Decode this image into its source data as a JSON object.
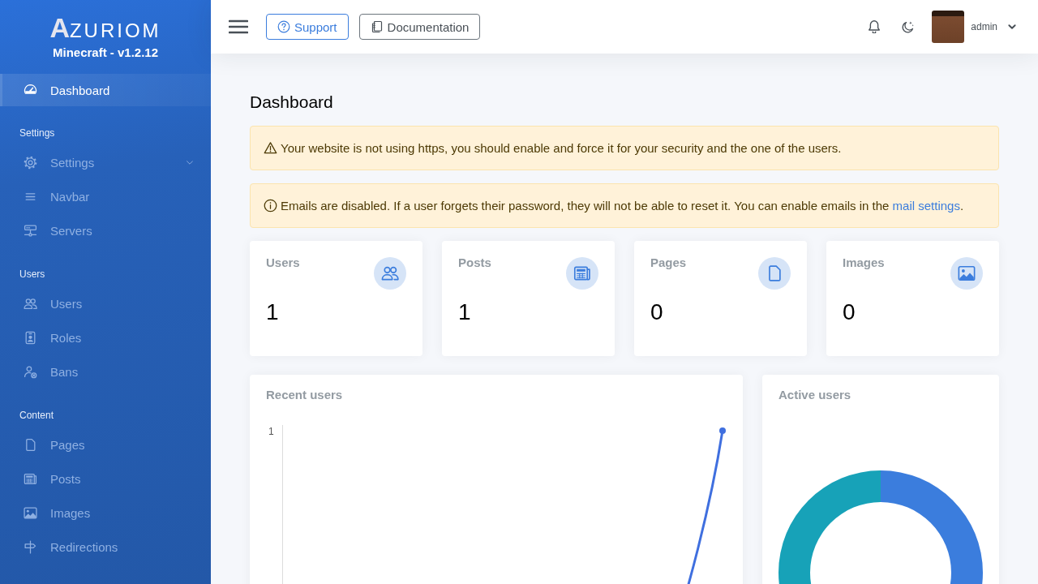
{
  "sidebar": {
    "logo": "**A**ZURIOM",
    "subtitle": "Minecraft - v1.2.12",
    "sections": [
      {
        "items": [
          {
            "label": "Dashboard",
            "kind": "link",
            "selected": true
          }
        ]
      },
      {
        "heading": "Settings",
        "items": [
          {
            "label": "Settings",
            "kind": "dropdown",
            "selected": false
          },
          {
            "label": "Navbar",
            "kind": "link",
            "selected": false
          },
          {
            "label": "Servers",
            "kind": "link",
            "selected": false
          }
        ]
      },
      {
        "heading": "Users",
        "items": [
          {
            "label": "Users",
            "kind": "link",
            "selected": false
          },
          {
            "label": "Roles",
            "kind": "link",
            "selected": false
          },
          {
            "label": "Bans",
            "kind": "link",
            "selected": false
          }
        ]
      },
      {
        "heading": "Content",
        "items": [
          {
            "label": "Pages",
            "kind": "link",
            "selected": false
          },
          {
            "label": "Posts",
            "kind": "link",
            "selected": false
          },
          {
            "label": "Images",
            "kind": "link",
            "selected": false
          },
          {
            "label": "Redirections",
            "kind": "link",
            "selected": false
          }
        ]
      }
    ]
  },
  "topbar": {
    "buttons": [
      {
        "label": "Support",
        "kind": "primary"
      },
      {
        "label": "Documentation",
        "kind": "secondary"
      }
    ],
    "user": {
      "name": "admin"
    }
  },
  "page": {
    "title": "Dashboard",
    "alerts": [
      {
        "kind": "warning",
        "text": "Your website is not using https, you should enable and force it for your security and the one of the users."
      },
      {
        "kind": "info",
        "text": "Emails are disabled. If a user forgets their password, they will not be able to reset it. You can enable emails in the",
        "link": "mail settings",
        "text_after": "."
      }
    ],
    "stats": [
      {
        "label": "Users",
        "value": "1"
      },
      {
        "label": "Posts",
        "value": "1"
      },
      {
        "label": "Pages",
        "value": "0"
      },
      {
        "label": "Images",
        "value": "0"
      }
    ],
    "recent_users": {
      "title": "Recent users",
      "y_tick": "1"
    },
    "active_users": {
      "title": "Active users"
    }
  }
}
